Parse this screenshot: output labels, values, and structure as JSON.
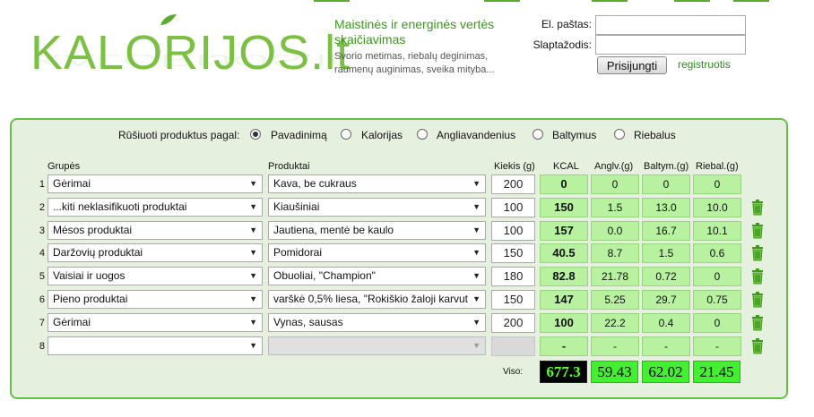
{
  "brand": {
    "logo_text": "KALORIJOS.lt",
    "colors": {
      "accent": "#7cc043",
      "panel_border": "#6abd45",
      "cell_green": "#b8f2a0"
    }
  },
  "tagline": {
    "title": "Maistinės ir energinės vertės skaičiavimas",
    "subtitle": "Svorio metimas, riebalų deginimas, raumenų auginimas, sveika mityba..."
  },
  "login": {
    "email_label": "El. paštas:",
    "password_label": "Slaptažodis:",
    "email_value": "",
    "password_value": "",
    "button": "Prisijungti",
    "register": "registruotis"
  },
  "sort": {
    "label": "Rūšiuoti produktus pagal:",
    "selected": "Pavadinimą",
    "options": [
      "Pavadinimą",
      "Kalorijas",
      "Angliavandenius",
      "Baltymus",
      "Riebalus"
    ]
  },
  "table": {
    "headers": {
      "groups": "Grupės",
      "products": "Produktai",
      "qty": "Kiekis (g)",
      "kcal": "KCAL",
      "carbs": "Anglv.(g)",
      "protein": "Baltym.(g)",
      "fat": "Riebal.(g)"
    },
    "rows": [
      {
        "n": "1",
        "group": "Gėrimai",
        "product": "Kava, be cukraus",
        "qty": "200",
        "kcal": "0",
        "carbs": "0",
        "protein": "0",
        "fat": "0"
      },
      {
        "n": "2",
        "group": "...kiti neklasifikuoti produktai",
        "product": "Kiaušiniai",
        "qty": "100",
        "kcal": "150",
        "carbs": "1.5",
        "protein": "13.0",
        "fat": "10.0"
      },
      {
        "n": "3",
        "group": "Mėsos produktai",
        "product": "Jautiena, mentė be kaulo",
        "qty": "100",
        "kcal": "157",
        "carbs": "0.0",
        "protein": "16.7",
        "fat": "10.1"
      },
      {
        "n": "4",
        "group": "Daržovių produktai",
        "product": "Pomidorai",
        "qty": "150",
        "kcal": "40.5",
        "carbs": "8.7",
        "protein": "1.5",
        "fat": "0.6"
      },
      {
        "n": "5",
        "group": "Vaisiai ir uogos",
        "product": "Obuoliai, \"Champion\"",
        "qty": "180",
        "kcal": "82.8",
        "carbs": "21.78",
        "protein": "0.72",
        "fat": "0"
      },
      {
        "n": "6",
        "group": "Pieno produktai",
        "product": "varškė 0,5% liesa, \"Rokiškio žaloji karvut",
        "qty": "150",
        "kcal": "147",
        "carbs": "5.25",
        "protein": "29.7",
        "fat": "0.75"
      },
      {
        "n": "7",
        "group": "Gėrimai",
        "product": "Vynas, sausas",
        "qty": "200",
        "kcal": "100",
        "carbs": "22.2",
        "protein": "0.4",
        "fat": "0"
      },
      {
        "n": "8",
        "group": "",
        "product": "",
        "qty": "",
        "kcal": "-",
        "carbs": "-",
        "protein": "-",
        "fat": "-"
      }
    ],
    "totals": {
      "label": "Viso:",
      "kcal": "677.3",
      "carbs": "59.43",
      "protein": "62.02",
      "fat": "21.45"
    }
  }
}
